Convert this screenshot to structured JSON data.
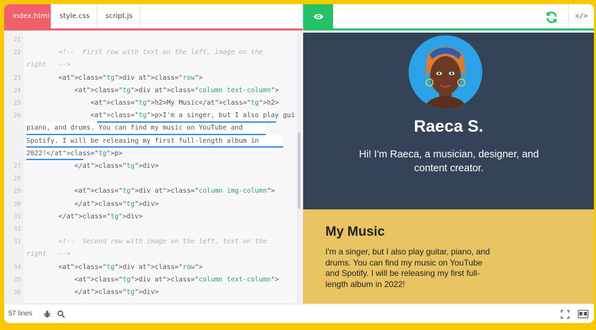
{
  "editor": {
    "tabs": [
      {
        "label": "index.html",
        "active": true
      },
      {
        "label": "style.css",
        "active": false
      },
      {
        "label": "script.js",
        "active": false
      }
    ],
    "lines": [
      {
        "n": "21",
        "text": ""
      },
      {
        "n": "22",
        "text": "        <!--  First row with text on the left, image on the"
      },
      {
        "n": "",
        "text": "right   -->"
      },
      {
        "n": "23",
        "text": "        <div class=\"row\">"
      },
      {
        "n": "24",
        "text": "            <div class=\"column text-column\">"
      },
      {
        "n": "25",
        "text": "                <h2>My Music</h2>"
      },
      {
        "n": "26",
        "text": "                <p>I'm a singer, but I also play guitar,"
      },
      {
        "n": "",
        "text": "piano, and drums. You can find my music on YouTube and"
      },
      {
        "n": "",
        "text": "Spotify. I will be releasing my first full-length album in"
      },
      {
        "n": "",
        "text": "2022!</p>"
      },
      {
        "n": "27",
        "text": "            </div>"
      },
      {
        "n": "28",
        "text": ""
      },
      {
        "n": "29",
        "text": "            <div class=\"column img-column\">"
      },
      {
        "n": "30",
        "text": "            </div>"
      },
      {
        "n": "31",
        "text": "        </div>"
      },
      {
        "n": "32",
        "text": ""
      },
      {
        "n": "33",
        "text": "        <!--  Second row with image on the left, text on the"
      },
      {
        "n": "",
        "text": "right   -->"
      },
      {
        "n": "34",
        "text": "        <div class=\"row\">"
      },
      {
        "n": "35",
        "text": "            <div class=\"column text-column\">"
      },
      {
        "n": "36",
        "text": "            </div>"
      }
    ]
  },
  "preview": {
    "name": "Raeca S.",
    "tagline": "Hi! I'm Raeca, a musician, designer, and content creator.",
    "music_heading": "My Music",
    "music_text": "I'm a singer, but I also play guitar, piano, and drums. You can find my music on YouTube and Spotify. I will be releasing my first full-length album in 2022!"
  },
  "toolbar": {
    "code_toggle": "</>",
    "eye_icon": "eye-icon",
    "refresh_icon": "refresh-icon"
  },
  "status": {
    "lines_count": "57 lines"
  },
  "colors": {
    "page_bg": "#f9c900",
    "editor_accent": "#f0606a",
    "preview_accent": "#25c165",
    "hero_bg": "#354358",
    "music_bg": "#e9c463"
  }
}
